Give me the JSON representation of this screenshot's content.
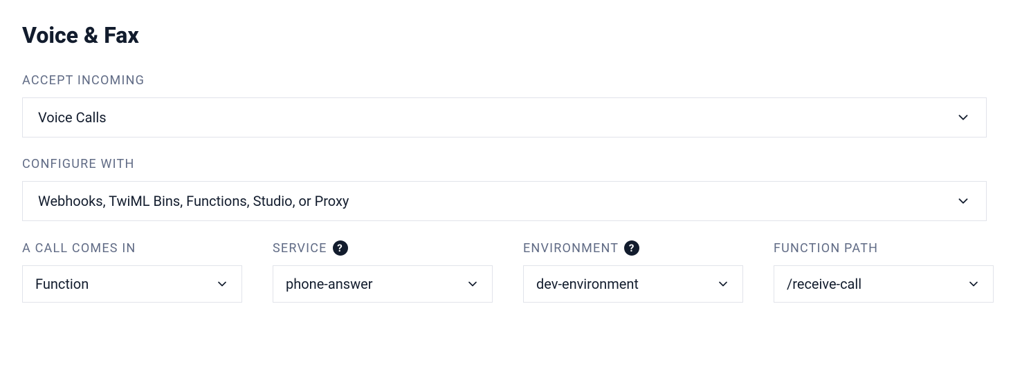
{
  "section": {
    "title": "Voice & Fax"
  },
  "fields": {
    "accept_incoming": {
      "label": "ACCEPT INCOMING",
      "value": "Voice Calls"
    },
    "configure_with": {
      "label": "CONFIGURE WITH",
      "value": "Webhooks, TwiML Bins, Functions, Studio, or Proxy"
    },
    "call_comes_in": {
      "label": "A CALL COMES IN",
      "value": "Function"
    },
    "service": {
      "label": "SERVICE",
      "value": "phone-answer"
    },
    "environment": {
      "label": "ENVIRONMENT",
      "value": "dev-environment"
    },
    "function_path": {
      "label": "FUNCTION PATH",
      "value": "/receive-call"
    }
  },
  "icons": {
    "help": "?"
  }
}
